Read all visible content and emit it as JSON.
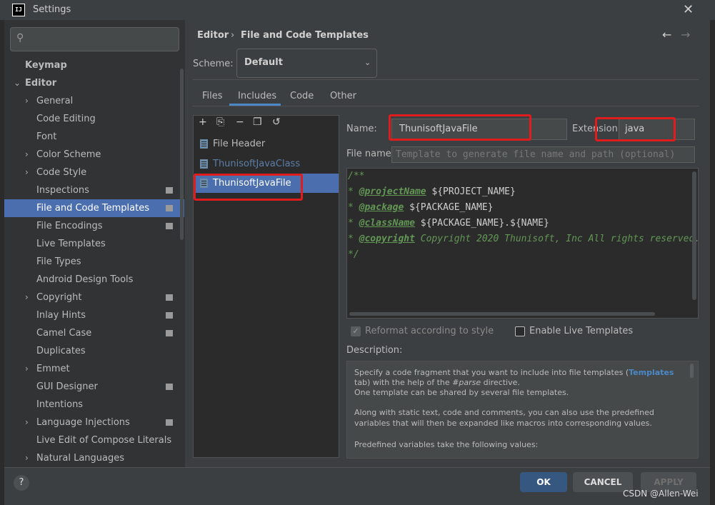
{
  "window": {
    "title": "Settings",
    "app_icon": "IJ"
  },
  "search": {
    "placeholder": "",
    "icon": "search-icon"
  },
  "sidebar": {
    "items": [
      {
        "label": "Keymap",
        "bold": true,
        "level": 0,
        "chevron": ""
      },
      {
        "label": "Editor",
        "bold": true,
        "level": 0,
        "chevron": "expanded"
      },
      {
        "label": "General",
        "level": 1,
        "chevron": "collapsed"
      },
      {
        "label": "Code Editing",
        "level": 1,
        "chevron": ""
      },
      {
        "label": "Font",
        "level": 1,
        "chevron": ""
      },
      {
        "label": "Color Scheme",
        "level": 1,
        "chevron": "collapsed"
      },
      {
        "label": "Code Style",
        "level": 1,
        "chevron": "collapsed"
      },
      {
        "label": "Inspections",
        "level": 1,
        "chevron": "",
        "badge": true
      },
      {
        "label": "File and Code Templates",
        "level": 1,
        "chevron": "",
        "badge": true,
        "selected": true
      },
      {
        "label": "File Encodings",
        "level": 1,
        "chevron": "",
        "badge": true
      },
      {
        "label": "Live Templates",
        "level": 1,
        "chevron": ""
      },
      {
        "label": "File Types",
        "level": 1,
        "chevron": ""
      },
      {
        "label": "Android Design Tools",
        "level": 1,
        "chevron": ""
      },
      {
        "label": "Copyright",
        "level": 1,
        "chevron": "collapsed",
        "badge": true
      },
      {
        "label": "Inlay Hints",
        "level": 1,
        "chevron": "",
        "badge": true
      },
      {
        "label": "Camel Case",
        "level": 1,
        "chevron": "",
        "badge": true
      },
      {
        "label": "Duplicates",
        "level": 1,
        "chevron": ""
      },
      {
        "label": "Emmet",
        "level": 1,
        "chevron": "collapsed"
      },
      {
        "label": "GUI Designer",
        "level": 1,
        "chevron": "",
        "badge": true
      },
      {
        "label": "Intentions",
        "level": 1,
        "chevron": ""
      },
      {
        "label": "Language Injections",
        "level": 1,
        "chevron": "collapsed",
        "badge": true
      },
      {
        "label": "Live Edit of Compose Literals",
        "level": 1,
        "chevron": ""
      },
      {
        "label": "Natural Languages",
        "level": 1,
        "chevron": "collapsed"
      }
    ]
  },
  "breadcrumb": {
    "parent": "Editor",
    "separator": "›",
    "current": "File and Code Templates"
  },
  "nav": {
    "back": "←",
    "forward": "→"
  },
  "scheme": {
    "label": "Scheme:",
    "value": "Default"
  },
  "tabs": [
    {
      "label": "Files",
      "active": false
    },
    {
      "label": "Includes",
      "active": true
    },
    {
      "label": "Code",
      "active": false
    },
    {
      "label": "Other",
      "active": false
    }
  ],
  "toolbar": {
    "add": "+",
    "copy_add": "⎘",
    "remove": "−",
    "copy": "❐",
    "reset": "↺"
  },
  "templates": [
    {
      "label": "File Header",
      "color": "#bbbbbb",
      "selected": false
    },
    {
      "label": "ThunisoftJavaClass",
      "color": "#5c7ea8",
      "selected": false
    },
    {
      "label": "ThunisoftJavaFile",
      "color": "#ffffff",
      "selected": true
    }
  ],
  "form": {
    "name_label": "Name:",
    "name_value": "ThunisoftJavaFile",
    "extension_label": "Extension:",
    "extension_value": "java",
    "filename_label": "File name:",
    "filename_placeholder": "Template to generate file name and path (optional)"
  },
  "code": {
    "line1": "/**",
    "line2_prefix": "* ",
    "line2_tag": "@projectName",
    "line2_var": " ${PROJECT_NAME}",
    "line3_prefix": "* ",
    "line3_tag": "@package",
    "line3_var": " ${PACKAGE_NAME}",
    "line4_prefix": "* ",
    "line4_tag": "@className",
    "line4_var": " ${PACKAGE_NAME}.${NAME}",
    "line5_prefix": "* ",
    "line5_tag": "@copyright",
    "line5_text": " Copyright 2020 Thunisoft, Inc All rights reserved.",
    "line6": "*/"
  },
  "options": {
    "reformat_label": "Reformat according to style",
    "reformat_checked": true,
    "live_label": "Enable Live Templates",
    "live_checked": false
  },
  "description": {
    "label": "Description:",
    "p1a": "Specify a code fragment that you want to include into file templates (",
    "p1link": "Templates",
    "p1b": "tab) with the help of the ",
    "p1em": "#parse",
    "p1c": " directive.",
    "p2": "One template can be shared by several file templates.",
    "p3a": "Along with static text, code and comments, you can also use the predefined",
    "p3b": "variables that will then be expanded like macros into corresponding values.",
    "p4": "Predefined variables take the following values:"
  },
  "buttons": {
    "help": "?",
    "ok": "OK",
    "cancel": "CANCEL",
    "apply": "APPLY"
  },
  "watermark": "CSDN @Allen-Wei",
  "colors": {
    "accent": "#4b6eaf",
    "highlight": "#e01c1c",
    "background": "#3c3f41"
  }
}
